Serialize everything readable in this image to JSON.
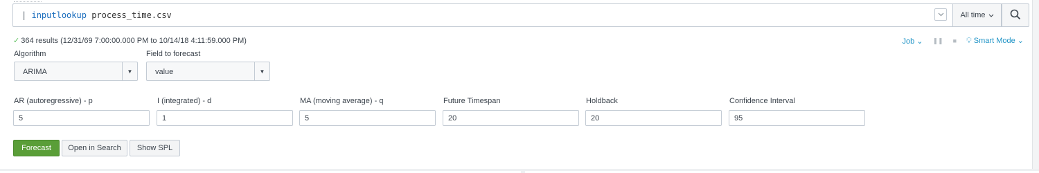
{
  "search": {
    "pipe": "|",
    "command": "inputlookup",
    "argument": "process_time.csv",
    "time_range": "All time"
  },
  "status": {
    "results_text": "364 results (12/31/69 7:00:00.000 PM to 10/14/18 4:11:59.000 PM)",
    "job_label": "Job",
    "mode_label": "Smart Mode"
  },
  "form": {
    "algorithm_label": "Algorithm",
    "algorithm_value": "ARIMA",
    "field_label": "Field to forecast",
    "field_value": "value",
    "params": [
      {
        "label": "AR (autoregressive) - p",
        "value": "5"
      },
      {
        "label": "I (integrated) - d",
        "value": "1"
      },
      {
        "label": "MA (moving average) - q",
        "value": "5"
      },
      {
        "label": "Future Timespan",
        "value": "20"
      },
      {
        "label": "Holdback",
        "value": "20"
      },
      {
        "label": "Confidence Interval",
        "value": "95"
      }
    ]
  },
  "buttons": {
    "forecast": "Forecast",
    "open_in_search": "Open in Search",
    "show_spl": "Show SPL"
  },
  "colors": {
    "accent": "#1e93c6",
    "primary_button": "#5a9e38",
    "success_check": "#5cc05c"
  }
}
